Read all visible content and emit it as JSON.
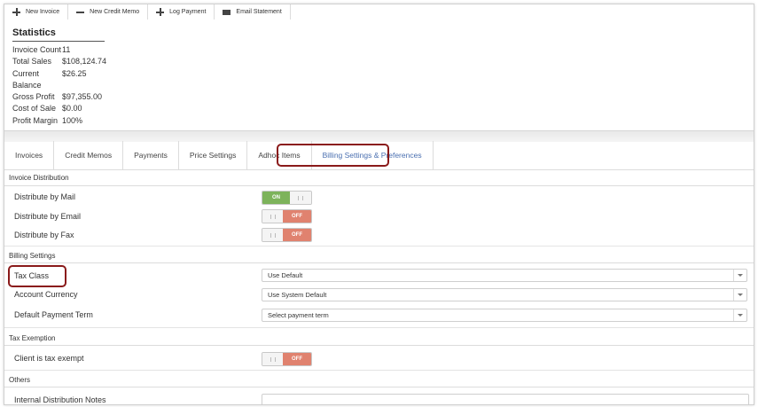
{
  "toolbar": {
    "new_invoice": "New Invoice",
    "new_credit_memo": "New Credit Memo",
    "log_payment": "Log Payment",
    "email_statement": "Email Statement"
  },
  "statistics": {
    "title": "Statistics",
    "rows": [
      {
        "label": "Invoice Count",
        "value": "11"
      },
      {
        "label": "Total Sales",
        "value": "$108,124.74"
      },
      {
        "label": "Current",
        "value": "$26.25"
      },
      {
        "label": "Balance",
        "value": ""
      },
      {
        "label": "Gross Profit",
        "value": "$97,355.00"
      },
      {
        "label": "Cost of Sale",
        "value": "$0.00"
      },
      {
        "label": "Profit Margin",
        "value": "100%"
      }
    ]
  },
  "tabs": [
    {
      "label": "Invoices"
    },
    {
      "label": "Credit Memos"
    },
    {
      "label": "Payments"
    },
    {
      "label": "Price Settings"
    },
    {
      "label": "Adhoc Items"
    },
    {
      "label": "Billing Settings & Preferences"
    }
  ],
  "invoice_distribution": {
    "heading": "Invoice Distribution",
    "mail": {
      "label": "Distribute by Mail",
      "state": "ON"
    },
    "email": {
      "label": "Distribute by Email",
      "state": "OFF"
    },
    "fax": {
      "label": "Distribute by Fax",
      "state": "OFF"
    }
  },
  "billing_settings": {
    "heading": "Billing Settings",
    "tax_class": {
      "label": "Tax Class",
      "value": "Use Default"
    },
    "account_currency": {
      "label": "Account Currency",
      "value": "Use System Default"
    },
    "payment_term": {
      "label": "Default Payment Term",
      "value": "Select payment term"
    }
  },
  "tax_exemption": {
    "heading": "Tax Exemption",
    "exempt": {
      "label": "Client is tax exempt",
      "state": "OFF"
    }
  },
  "others": {
    "heading": "Others",
    "notes": {
      "label": "Internal Distribution Notes",
      "value": ""
    }
  },
  "colors": {
    "on": "#7db35b",
    "off": "#e0826f",
    "highlight": "#8a1a1a",
    "active_tab": "#4a6fb0"
  }
}
